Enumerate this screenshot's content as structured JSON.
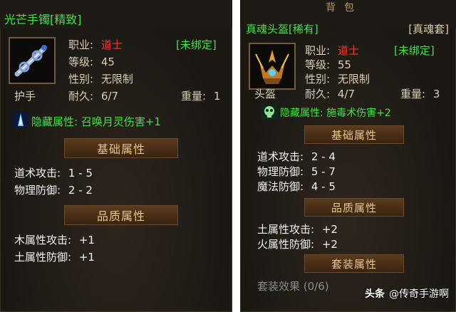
{
  "left": {
    "title": "光芒手镯[精致]",
    "profession_label": "职业:",
    "profession_value": "道士",
    "bind_status": "[未绑定]",
    "level_label": "等级:",
    "level_value": "45",
    "gender_label": "性别:",
    "gender_value": "无限制",
    "slot": "护手",
    "durability_label": "耐久:",
    "durability_value": "6/7",
    "weight_label": "重量:",
    "weight_value": "1",
    "hidden_attr": "隐藏属性: 召唤月灵伤害+1",
    "section_basic": "基础属性",
    "basic_stats": [
      {
        "label": "道术攻击:",
        "value": "1 - 5"
      },
      {
        "label": "物理防御:",
        "value": "2 - 2"
      }
    ],
    "section_quality": "品质属性",
    "quality_stats": [
      {
        "label": "木属性攻击:",
        "value": "+1"
      },
      {
        "label": "土属性防御:",
        "value": "+1"
      }
    ]
  },
  "right": {
    "bag_title": "背包",
    "title": "真魂头盔[稀有]",
    "set_tag": "[真魂套]",
    "profession_label": "职业:",
    "profession_value": "道士",
    "bind_status": "[未绑定]",
    "level_label": "等级:",
    "level_value": "55",
    "gender_label": "性别:",
    "gender_value": "无限制",
    "slot": "头盔",
    "durability_label": "耐久:",
    "durability_value": "4/7",
    "weight_label": "重量:",
    "weight_value": "3",
    "hidden_attr": "隐藏属性: 施毒术伤害+2",
    "section_basic": "基础属性",
    "basic_stats": [
      {
        "label": "道术攻击:",
        "value": "2 - 4"
      },
      {
        "label": "物理防御:",
        "value": "5 - 7"
      },
      {
        "label": "魔法防御:",
        "value": "4 - 5"
      }
    ],
    "section_quality": "品质属性",
    "quality_stats": [
      {
        "label": "土属性攻击:",
        "value": "+2"
      },
      {
        "label": "火属性防御:",
        "value": "+2"
      }
    ],
    "section_set": "套装属性",
    "set_effect": "套装效果 (0/6)"
  },
  "watermark": {
    "logo": "头条",
    "text": "@传奇手游啊"
  },
  "colors": {
    "green": "#45e04a",
    "red": "#f03a30",
    "gold": "#e6c68c",
    "panel_bg": "#1b1814"
  },
  "icons": {
    "left_item": "bracelet-icon",
    "right_item": "helmet-icon",
    "left_hidden": "moon-spirit-icon",
    "right_hidden": "poison-skull-icon"
  }
}
